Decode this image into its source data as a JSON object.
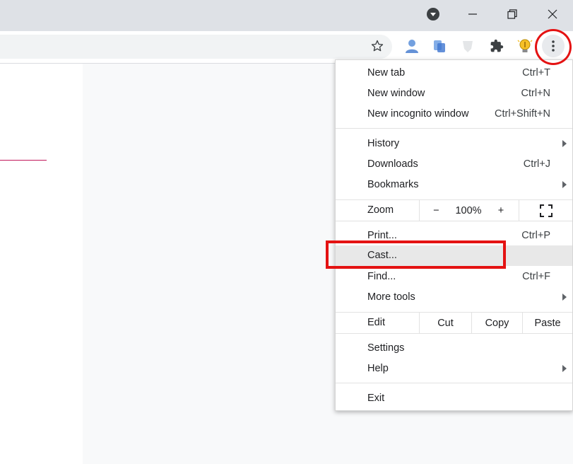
{
  "window_controls": {
    "profile": "profile-dropdown-icon",
    "minimize": "minimize-icon",
    "restore": "restore-icon",
    "close": "close-icon"
  },
  "toolbar": {
    "star": "star-icon",
    "extensions": "puzzle-icon",
    "menu": "kebab-menu-icon"
  },
  "menu": {
    "group1": [
      {
        "label": "New tab",
        "shortcut": "Ctrl+T"
      },
      {
        "label": "New window",
        "shortcut": "Ctrl+N"
      },
      {
        "label": "New incognito window",
        "shortcut": "Ctrl+Shift+N"
      }
    ],
    "group2": [
      {
        "label": "History",
        "shortcut": ""
      },
      {
        "label": "Downloads",
        "shortcut": "Ctrl+J"
      },
      {
        "label": "Bookmarks",
        "shortcut": ""
      }
    ],
    "zoom": {
      "label": "Zoom",
      "minus": "−",
      "value": "100%",
      "plus": "+"
    },
    "group3": [
      {
        "label": "Print...",
        "shortcut": "Ctrl+P"
      },
      {
        "label": "Cast...",
        "shortcut": ""
      },
      {
        "label": "Find...",
        "shortcut": "Ctrl+F"
      },
      {
        "label": "More tools",
        "shortcut": ""
      }
    ],
    "edit": {
      "label": "Edit",
      "cut": "Cut",
      "copy": "Copy",
      "paste": "Paste"
    },
    "group4": [
      {
        "label": "Settings",
        "shortcut": ""
      },
      {
        "label": "Help",
        "shortcut": ""
      }
    ],
    "exit": {
      "label": "Exit"
    }
  },
  "highlight": {
    "color": "#e41212"
  }
}
